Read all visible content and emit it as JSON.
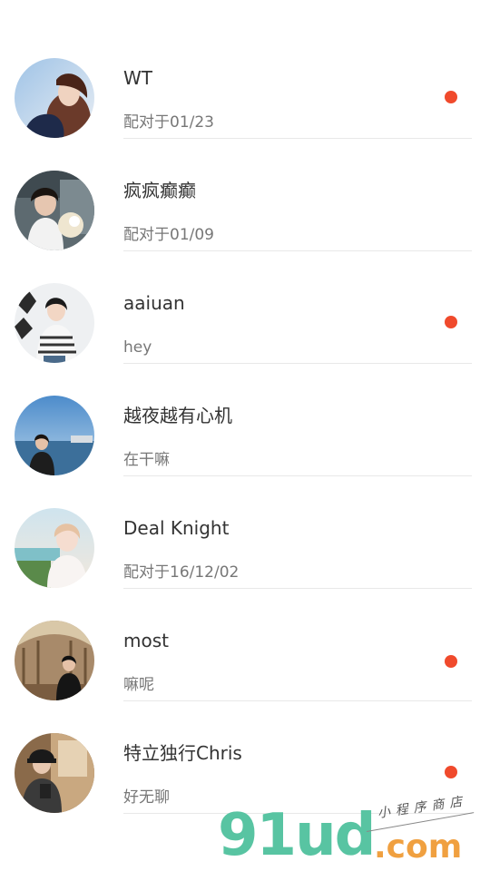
{
  "conversations": [
    {
      "name": "WT",
      "preview": "配对于01/23",
      "unread": true
    },
    {
      "name": "疯疯癫癫",
      "preview": "配对于01/09",
      "unread": false
    },
    {
      "name": "aaiuan",
      "preview": "hey",
      "unread": true
    },
    {
      "name": "越夜越有心机",
      "preview": "在干嘛",
      "unread": false
    },
    {
      "name": "Deal Knight",
      "preview": "配对于16/12/02",
      "unread": false
    },
    {
      "name": "most",
      "preview": "嘛呢",
      "unread": true
    },
    {
      "name": "特立独行Chris",
      "preview": "好无聊",
      "unread": true
    }
  ],
  "unread_color": "#f04a2c",
  "watermark": {
    "logo": "91ud",
    "domain": ".com",
    "tagline": "小程序商店"
  }
}
